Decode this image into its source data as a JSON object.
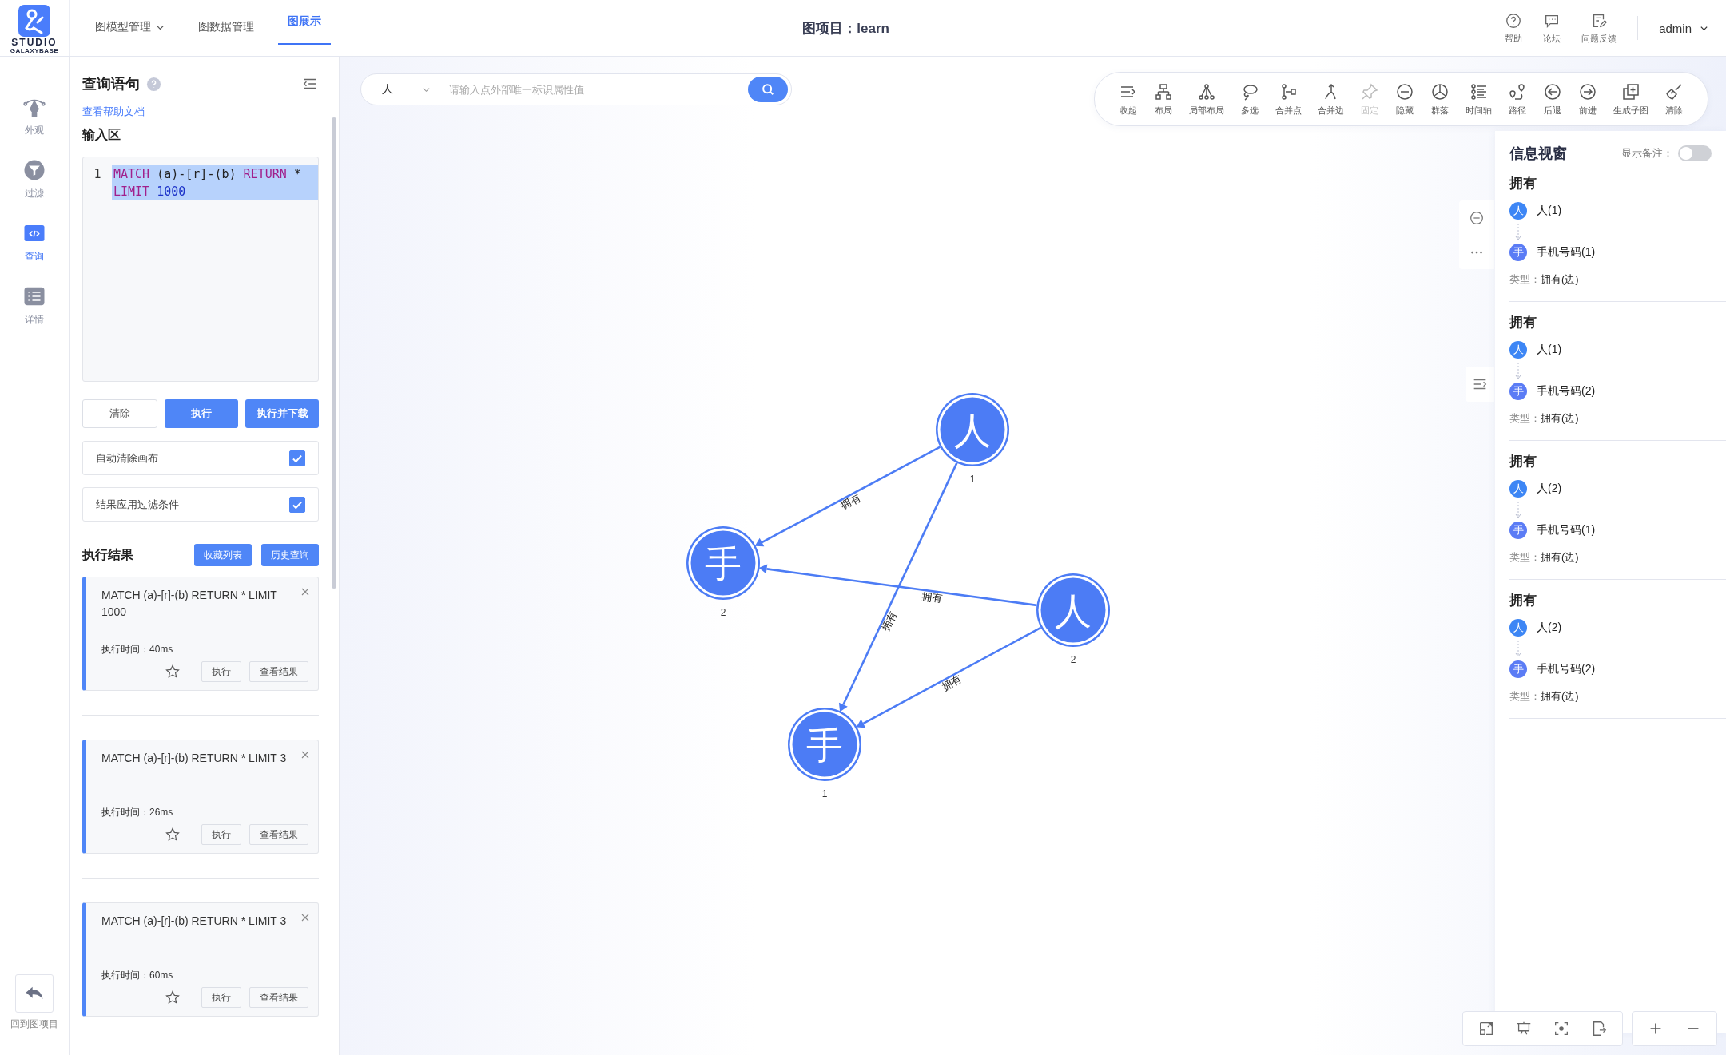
{
  "header": {
    "logo_text": "STUDIO",
    "logo_subtext": "GALAXYBASE",
    "nav": [
      {
        "label": "图模型管理",
        "has_menu": true,
        "selected": false
      },
      {
        "label": "图数据管理",
        "has_menu": false,
        "selected": false
      },
      {
        "label": "图展示",
        "has_menu": false,
        "selected": true
      }
    ],
    "project_title": "图项目：learn",
    "actions": [
      {
        "label": "帮助"
      },
      {
        "label": "论坛"
      },
      {
        "label": "问题反馈"
      }
    ],
    "user": "admin"
  },
  "rail": {
    "items": [
      {
        "label": "外观",
        "selected": false
      },
      {
        "label": "过滤",
        "selected": false
      },
      {
        "label": "查询",
        "selected": true
      },
      {
        "label": "详情",
        "selected": false
      }
    ],
    "back_label": "回到图项目"
  },
  "query_panel": {
    "title": "查询语句",
    "help_link": "查看帮助文档",
    "input_label": "输入区",
    "editor": {
      "line_number": "1",
      "selected": true,
      "tokens": [
        {
          "text": "MATCH",
          "kind": "keyword"
        },
        {
          "text": " (a)-[r]-(b) ",
          "kind": "plain"
        },
        {
          "text": "RETURN",
          "kind": "keyword"
        },
        {
          "text": " * ",
          "kind": "plain"
        },
        {
          "text": "LIMIT",
          "kind": "keyword"
        },
        {
          "text": " 1000",
          "kind": "number"
        }
      ]
    },
    "buttons": [
      {
        "label": "清除",
        "kind": "outline"
      },
      {
        "label": "执行",
        "kind": "primary"
      },
      {
        "label": "执行并下载",
        "kind": "primary"
      }
    ],
    "options": [
      {
        "label": "自动清除画布",
        "checked": true
      },
      {
        "label": "结果应用过滤条件",
        "checked": true
      }
    ],
    "results_title": "执行结果",
    "results_buttons": [
      "收藏列表",
      "历史查询"
    ],
    "results": [
      {
        "query": "MATCH (a)-[r]-(b) RETURN * LIMIT 1000",
        "time": "执行时间：40ms",
        "starred": false,
        "actions": [
          "执行",
          "查看结果"
        ]
      },
      {
        "query": "MATCH (a)-[r]-(b) RETURN * LIMIT 3",
        "time": "执行时间：26ms",
        "starred": false,
        "actions": [
          "执行",
          "查看结果"
        ]
      },
      {
        "query": "MATCH (a)-[r]-(b) RETURN * LIMIT 3",
        "time": "执行时间：60ms",
        "starred": false,
        "actions": [
          "执行",
          "查看结果"
        ]
      }
    ]
  },
  "search": {
    "type_value": "人",
    "placeholder": "请输入点外部唯一标识属性值"
  },
  "toolbar": [
    {
      "label": "收起",
      "disabled": false
    },
    {
      "label": "布局",
      "disabled": false
    },
    {
      "label": "局部布局",
      "disabled": false
    },
    {
      "label": "多选",
      "disabled": false
    },
    {
      "label": "合并点",
      "disabled": false
    },
    {
      "label": "合并边",
      "disabled": false
    },
    {
      "label": "固定",
      "disabled": true
    },
    {
      "label": "隐藏",
      "disabled": false
    },
    {
      "label": "群落",
      "disabled": false
    },
    {
      "label": "时间轴",
      "disabled": false
    },
    {
      "label": "路径",
      "disabled": false
    },
    {
      "label": "后退",
      "disabled": false
    },
    {
      "label": "前进",
      "disabled": false
    },
    {
      "label": "生成子图",
      "disabled": false
    },
    {
      "label": "清除",
      "disabled": false
    }
  ],
  "graph": {
    "nodes": [
      {
        "glyph": "人",
        "label": "1"
      },
      {
        "glyph": "手",
        "label": "2"
      },
      {
        "glyph": "人",
        "label": "2"
      },
      {
        "glyph": "手",
        "label": "1"
      }
    ],
    "edges": [
      {
        "label": "拥有"
      },
      {
        "label": "拥有"
      },
      {
        "label": "拥有"
      },
      {
        "label": "拥有"
      }
    ]
  },
  "info_panel": {
    "title": "信息视窗",
    "toggle_label": "显示备注：",
    "toggle_on": false,
    "cards": [
      {
        "title": "拥有",
        "source": {
          "badge": "人",
          "label": "人(1)"
        },
        "target": {
          "badge": "手",
          "label": "手机号码(1)"
        },
        "type_label": "类型：",
        "type_value": "拥有(边)"
      },
      {
        "title": "拥有",
        "source": {
          "badge": "人",
          "label": "人(1)"
        },
        "target": {
          "badge": "手",
          "label": "手机号码(2)"
        },
        "type_label": "类型：",
        "type_value": "拥有(边)"
      },
      {
        "title": "拥有",
        "source": {
          "badge": "人",
          "label": "人(2)"
        },
        "target": {
          "badge": "手",
          "label": "手机号码(1)"
        },
        "type_label": "类型：",
        "type_value": "拥有(边)"
      },
      {
        "title": "拥有",
        "source": {
          "badge": "人",
          "label": "人(2)"
        },
        "target": {
          "badge": "手",
          "label": "手机号码(2)"
        },
        "type_label": "类型：",
        "type_value": "拥有(边)"
      }
    ]
  }
}
